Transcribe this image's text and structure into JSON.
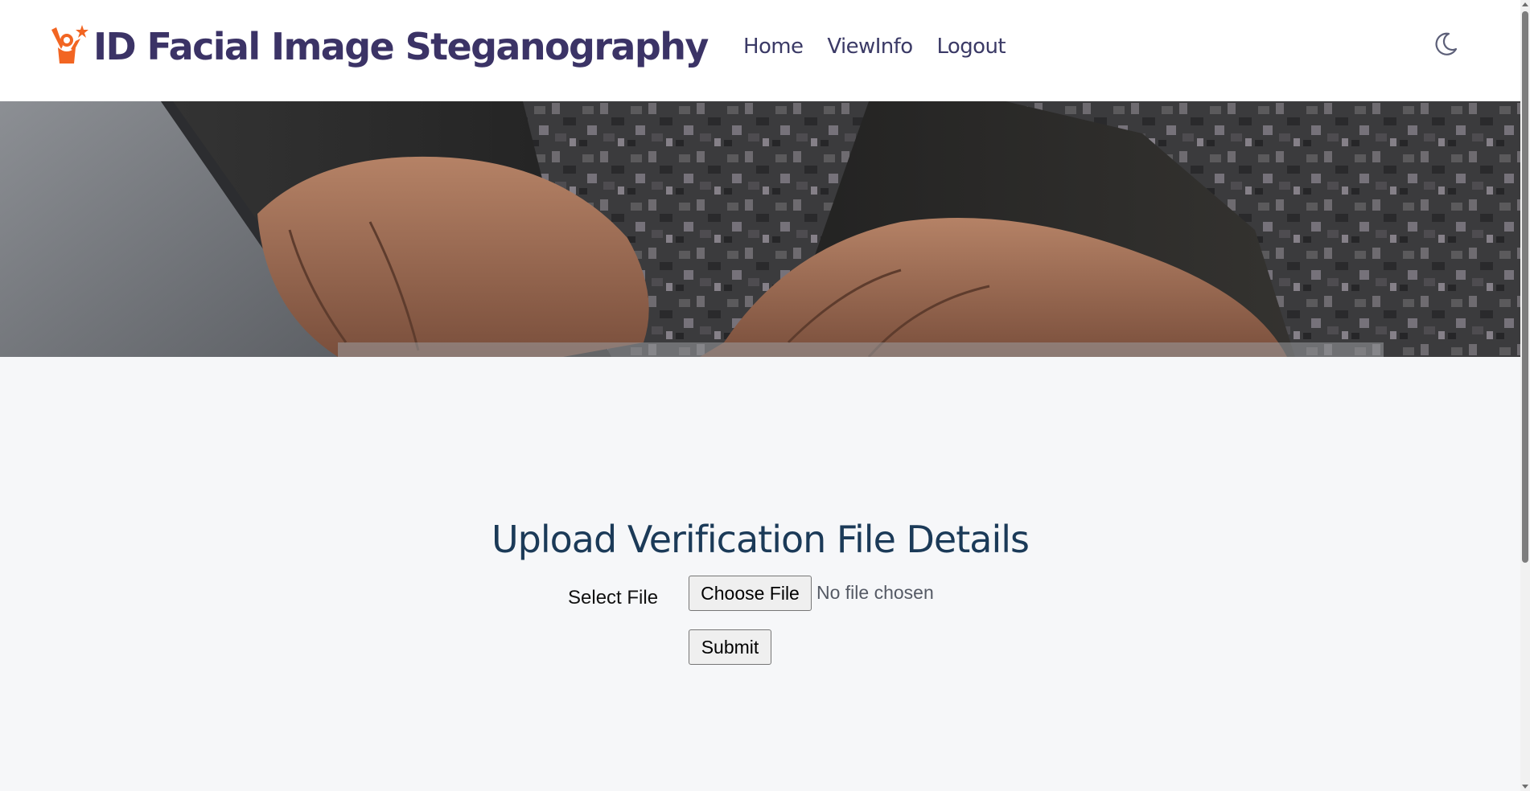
{
  "header": {
    "brand_title": "ID Facial Image Steganography",
    "brand_icon": "person-star-icon",
    "nav": [
      {
        "label": "Home"
      },
      {
        "label": "ViewInfo"
      },
      {
        "label": "Logout"
      }
    ],
    "theme_toggle_icon": "moon-icon"
  },
  "hero": {
    "image": "hands-typing-on-laptop-camouflage-sleeves"
  },
  "upload": {
    "title": "Upload Verification File Details",
    "select_label": "Select File",
    "choose_button": "Choose File",
    "file_status": "No file chosen",
    "submit_button": "Submit"
  },
  "colors": {
    "brand_text": "#3b3366",
    "brand_icon": "#f26522",
    "nav_text": "#3b3a66",
    "title_text": "#1b3a58",
    "page_bg": "#f6f7f9"
  }
}
